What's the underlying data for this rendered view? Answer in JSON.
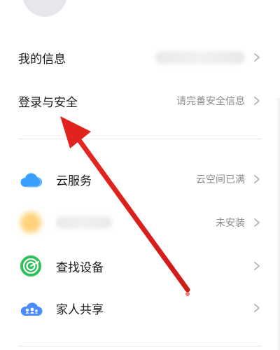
{
  "menu": {
    "my_info": {
      "label": "我的信息"
    },
    "login_security": {
      "label": "登录与安全",
      "value": "请完善安全信息"
    },
    "cloud": {
      "label": "云服务",
      "value": "云空间已满"
    },
    "blurred_app": {
      "value": "未安装"
    },
    "find_device": {
      "label": "查找设备"
    },
    "family_share": {
      "label": "家人共享"
    }
  },
  "annotation": {
    "arrow_color": "#e1231e",
    "note": ""
  },
  "icons": {
    "avatar": "avatar-icon",
    "chevron": "chevron-right-icon",
    "cloud": "cloud-icon",
    "app": "app-icon",
    "find": "find-device-icon",
    "family": "family-share-icon"
  },
  "colors": {
    "cloud": "#3aa0ff",
    "find": "#2fbf5a",
    "family": "#4a8cff",
    "app_blur": "#ffd27a",
    "text_secondary": "#8c8c8c",
    "divider": "#e8e8e8"
  }
}
